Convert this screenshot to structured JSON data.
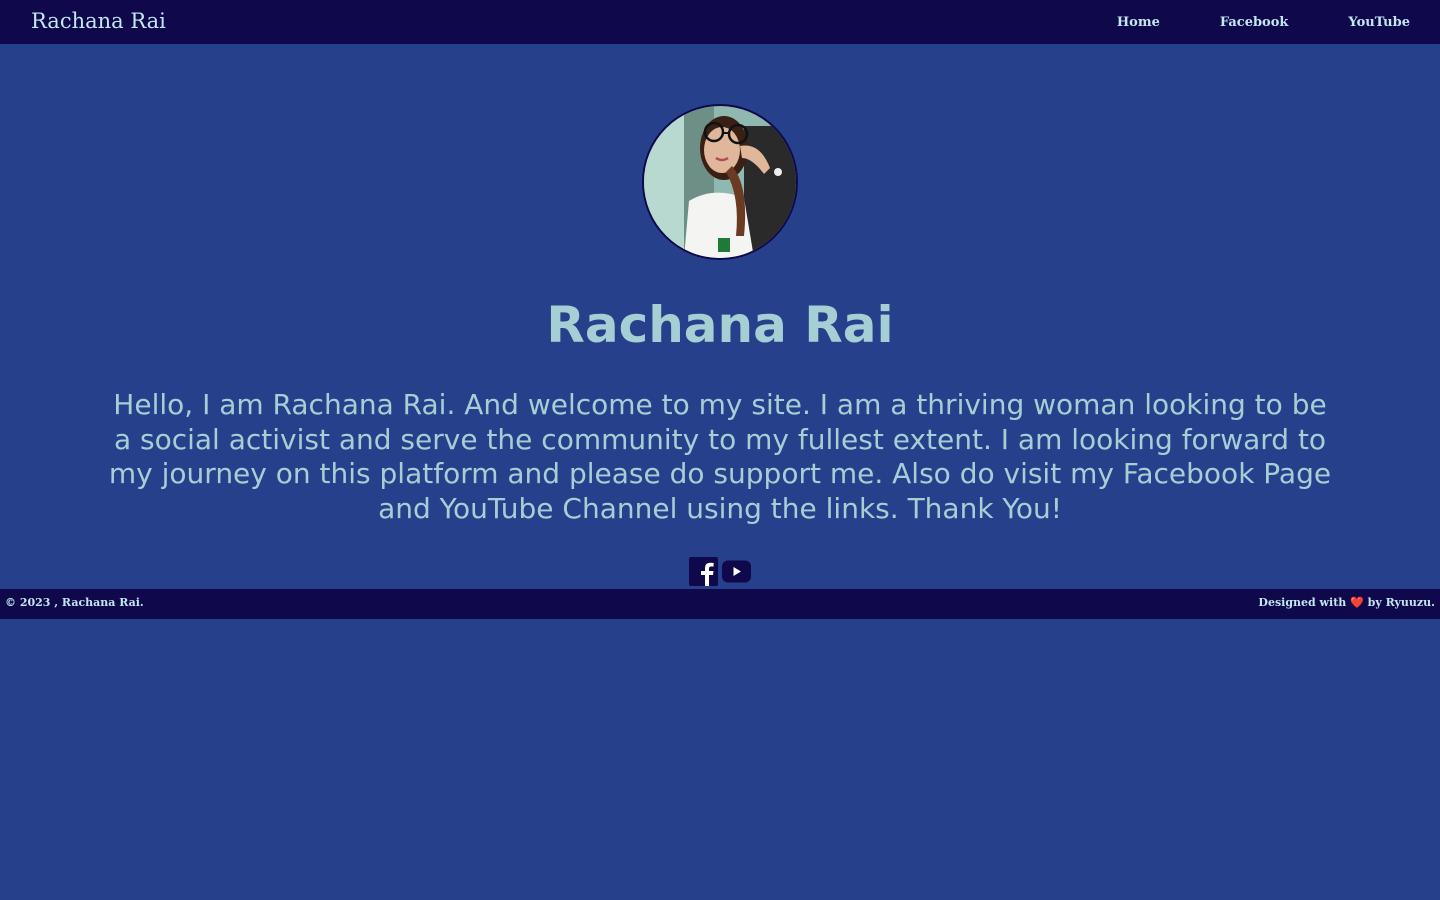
{
  "header": {
    "brand": "Rachana Rai",
    "nav": [
      {
        "label": "Home"
      },
      {
        "label": "Facebook"
      },
      {
        "label": "YouTube"
      }
    ]
  },
  "profile": {
    "name": "Rachana Rai",
    "bio": "Hello, I am Rachana Rai. And welcome to my site. I am a thriving woman looking to be a social activist and serve the community to my fullest extent. I am looking forward to my journey on this platform and please do support me. Also do visit my Facebook Page and YouTube Channel using the links. Thank You!"
  },
  "social_icons": [
    {
      "icon": "facebook-icon"
    },
    {
      "icon": "youtube-icon"
    }
  ],
  "footer": {
    "copyright": "© 2023 , Rachana Rai.",
    "designed_prefix": "Designed with",
    "heart": "❤️",
    "designed_suffix": "by Ryuuzu."
  },
  "colors": {
    "background": "#26408b",
    "navbar": "#0f084b",
    "nav_text": "#c2e7f3",
    "heading_text": "#a6cfd5"
  }
}
